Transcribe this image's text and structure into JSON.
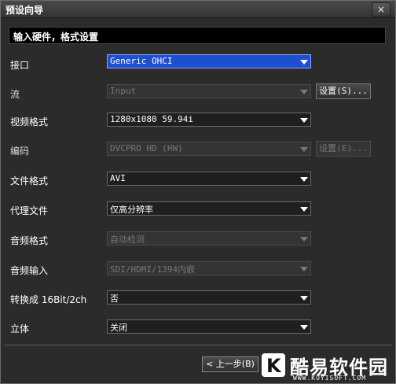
{
  "window": {
    "title": "预设向导",
    "close_label": "×"
  },
  "section": {
    "header": "输入硬件，格式设置"
  },
  "rows": [
    {
      "label": "接口",
      "value": "Generic OHCI",
      "state": "active"
    },
    {
      "label": "流",
      "value": "Input",
      "state": "disabled",
      "button": "设置(S)..."
    },
    {
      "label": "视频格式",
      "value": "1280x1080 59.94i",
      "state": "normal"
    },
    {
      "label": "编码",
      "value": "DVCPRO HD (HW)",
      "state": "disabled",
      "button": "设置(E)..."
    },
    {
      "label": "文件格式",
      "value": "AVI",
      "state": "normal"
    },
    {
      "label": "代理文件",
      "value": "仅高分辨率",
      "state": "normal"
    },
    {
      "label": "音频格式",
      "value": "自动检测",
      "state": "disabled"
    },
    {
      "label": "音频输入",
      "value": "SDI/HDMI/1394内嵌",
      "state": "disabled"
    },
    {
      "label": "转换成 16Bit/2ch",
      "value": "否",
      "state": "normal"
    },
    {
      "label": "立体",
      "value": "关闭",
      "state": "normal"
    }
  ],
  "footer": {
    "prev_label": "< 上一步(B)"
  },
  "watermark": {
    "logo_letter": "K",
    "name": "酷易软件园",
    "url": "WWW.KUYISOFT.COM"
  }
}
